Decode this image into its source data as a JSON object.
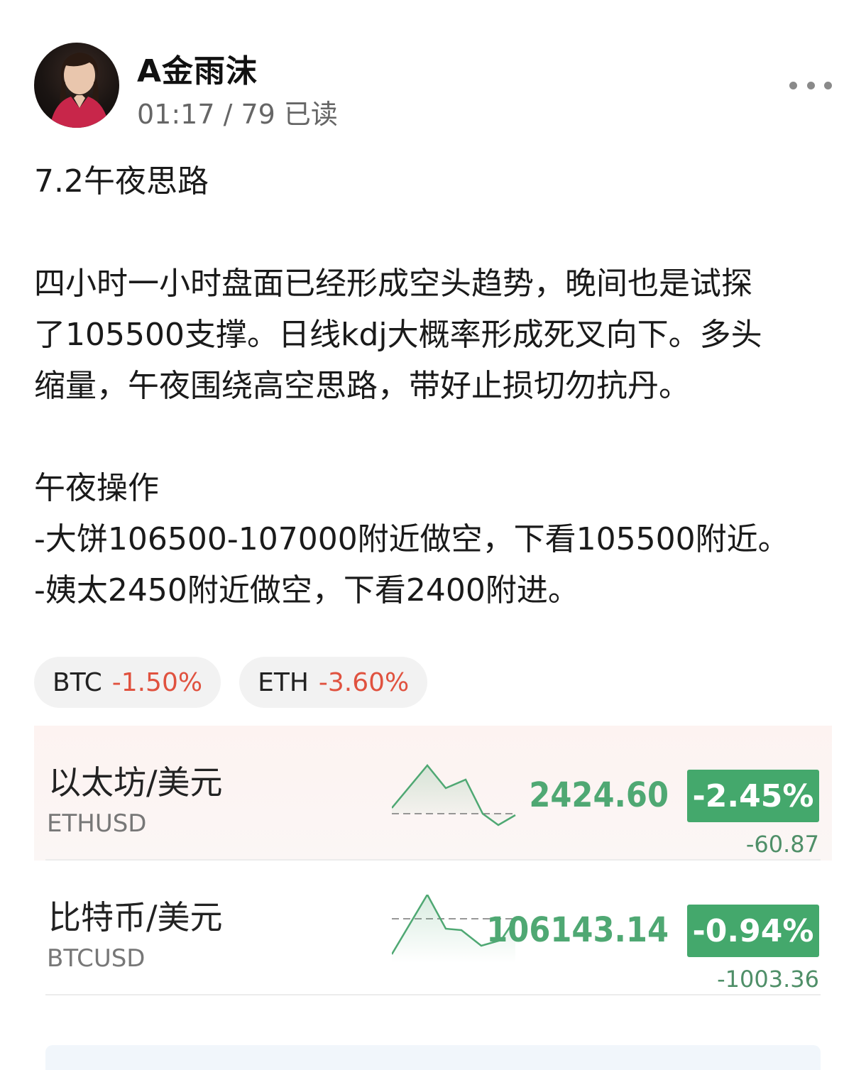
{
  "author": {
    "name": "A金雨沫",
    "meta": "01:17 / 79 已读"
  },
  "post": {
    "title": "7.2午夜思路",
    "para1_line1": "四小时一小时盘面已经形成空头趋势，晚间也是试探",
    "para1_line2": "了105500支撑。日线kdj大概率形成死叉向下。多头",
    "para1_line3": "缩量，午夜围绕高空思路，带好止损切勿抗丹。",
    "ops_title": "午夜操作",
    "op1": "-大饼106500-107000附近做空，下看105500附近。",
    "op2": "-姨太2450附近做空，下看2400附进。"
  },
  "tags": [
    {
      "symbol": "BTC",
      "change": "-1.50%"
    },
    {
      "symbol": "ETH",
      "change": "-3.60%"
    }
  ],
  "quotes": [
    {
      "name": "以太坊/美元",
      "code": "ETHUSD",
      "price": "2424.60",
      "change_pct": "-2.45%",
      "change_abs": "-60.87"
    },
    {
      "name": "比特币/美元",
      "code": "BTCUSD",
      "price": "106143.14",
      "change_pct": "-0.94%",
      "change_abs": "-1003.36"
    }
  ],
  "colors": {
    "negative_red": "#e0523f",
    "quote_green": "#44a86c",
    "sparkline_green": "#4fa873"
  },
  "icons": {
    "more": "more-dots-icon"
  }
}
